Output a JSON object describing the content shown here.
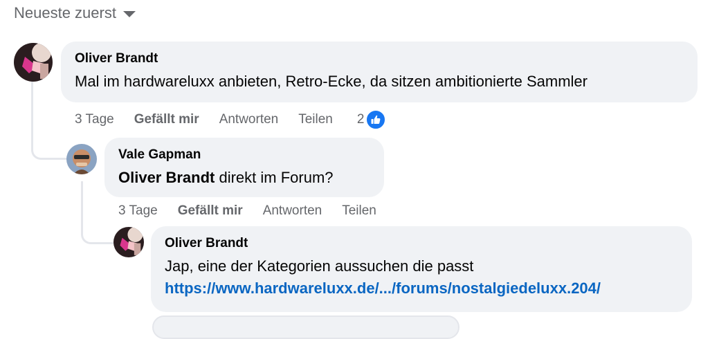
{
  "sort": {
    "label": "Neueste zuerst",
    "icon": "caret-down-icon"
  },
  "comments": [
    {
      "author": "Oliver Brandt",
      "text": "Mal im hardwareluxx anbieten, Retro-Ecke, da sitzen ambitionierte Sammler",
      "actions": {
        "time": "3 Tage",
        "like": "Gefällt mir",
        "reply": "Antworten",
        "share": "Teilen"
      },
      "reactions": {
        "count": "2",
        "icon": "thumbs-up-icon"
      }
    },
    {
      "author": "Vale Gapman",
      "mention": "Oliver Brandt",
      "text": " direkt im Forum?",
      "actions": {
        "time": "3 Tage",
        "like": "Gefällt mir",
        "reply": "Antworten",
        "share": "Teilen"
      }
    },
    {
      "author": "Oliver Brandt",
      "text": "Jap, eine der Kategorien aussuchen die passt",
      "link": "https://www.hardwareluxx.de/.../forums/nostalgiedeluxx.204/"
    }
  ],
  "colors": {
    "bubble": "#f0f2f5",
    "link": "#0a66c2",
    "like_blue": "#1877f2",
    "meta": "#65676b"
  }
}
